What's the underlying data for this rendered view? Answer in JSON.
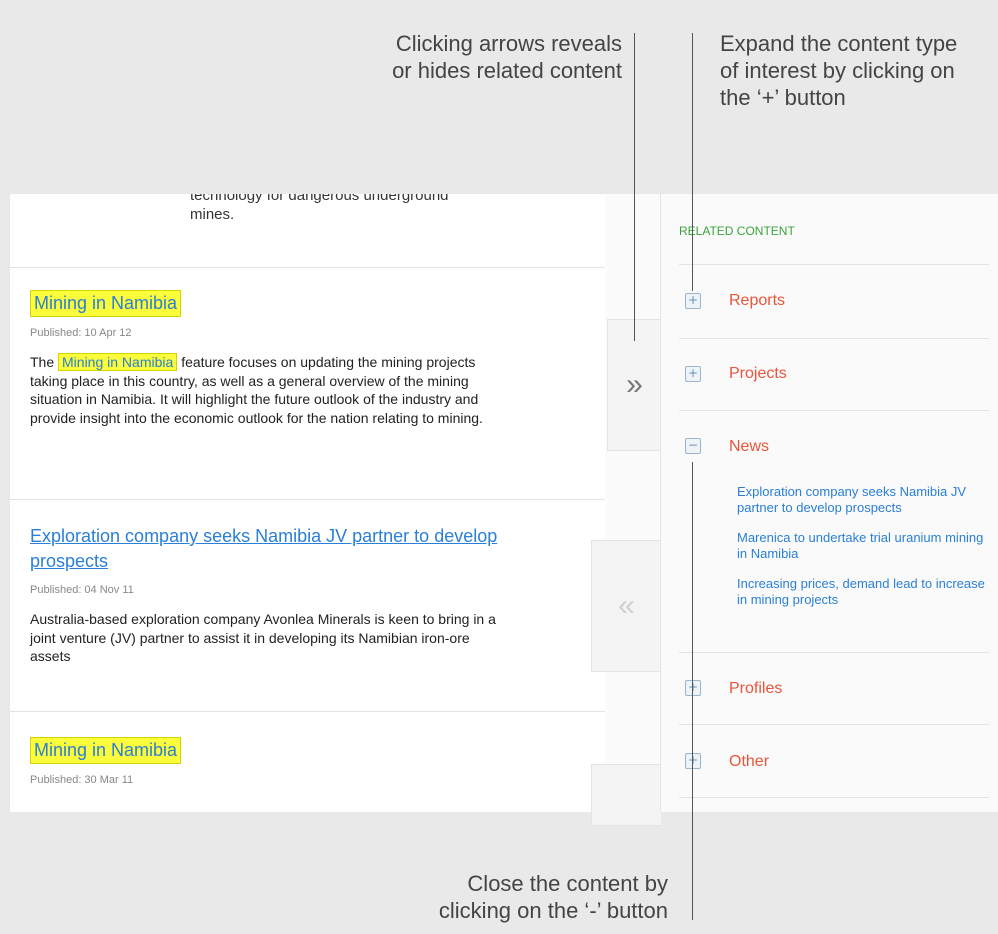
{
  "annotations": {
    "top_left": [
      "Clicking arrows reveals",
      "or hides related content"
    ],
    "top_right": [
      "Expand the content type",
      "of interest by clicking on",
      "the ‘+’ button"
    ],
    "bottom": [
      "Close the content by",
      "clicking on the ‘-’ button"
    ]
  },
  "intro_tail": [
    "technology for dangerous underground",
    "mines."
  ],
  "articles": [
    {
      "title": "Mining in Namibia",
      "published": "Published: 10 Apr 12",
      "body_prefix": "The",
      "body_highlight": "Mining in Namibia",
      "body_rest": "feature focuses on updating the mining projects taking place in this country, as well as a general overview of the mining situation in Namibia. It will highlight the future outlook of the industry and provide insight into the economic outlook for the nation relating to mining."
    },
    {
      "title": "Exploration company seeks Namibia JV partner to develop prospects",
      "published": "Published: 04 Nov 11",
      "body": "Australia-based exploration company Avonlea Minerals is keen to bring in a joint venture (JV) partner to assist it in developing its Namibian iron-ore assets"
    },
    {
      "title": "Mining in Namibia",
      "published": "Published: 30 Mar 11"
    }
  ],
  "toggles": {
    "collapse": "»",
    "expand": "«"
  },
  "sidebar": {
    "heading": "RELATED CONTENT",
    "items": [
      {
        "label": "Reports",
        "icon": "+"
      },
      {
        "label": "Projects",
        "icon": "+"
      },
      {
        "label": "News",
        "icon": "−"
      },
      {
        "label": "Profiles",
        "icon": "+"
      },
      {
        "label": "Other",
        "icon": "+"
      }
    ],
    "news_links": [
      "Exploration company seeks Namibia JV partner to develop prospects",
      "Marenica to undertake trial uranium mining in Namibia",
      "Increasing prices, demand lead to increase in mining projects"
    ]
  },
  "colors": {
    "accent_link": "#2a7fd6",
    "category": "#e8553a",
    "heading_green": "#3aa43a",
    "highlight": "#fbfc3a"
  }
}
